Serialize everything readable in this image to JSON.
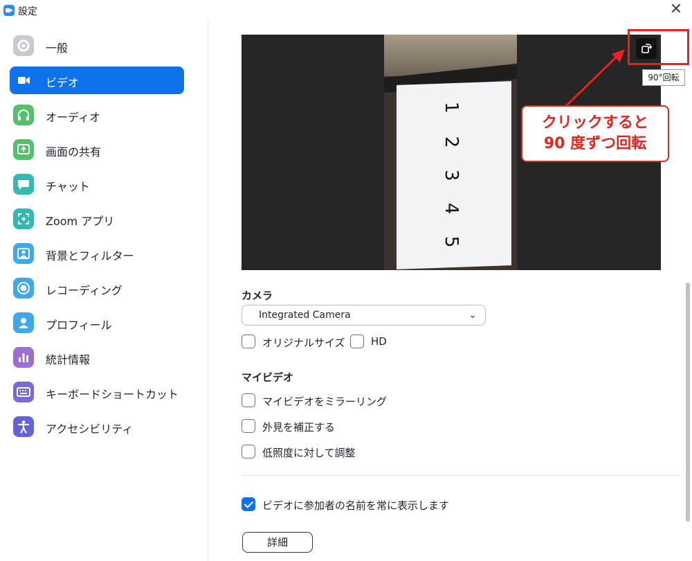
{
  "window": {
    "title": "設定",
    "close_glyph": "✕"
  },
  "sidebar": {
    "items": [
      {
        "label": "一般",
        "icon": "gear-icon",
        "color": "#c9c9cf",
        "active": false
      },
      {
        "label": "ビデオ",
        "icon": "video-camera-icon",
        "color": "#0e72ed",
        "active": true
      },
      {
        "label": "オーディオ",
        "icon": "headphones-icon",
        "color": "#54c06e",
        "active": false
      },
      {
        "label": "画面の共有",
        "icon": "screen-share-icon",
        "color": "#54c06e",
        "active": false
      },
      {
        "label": "チャット",
        "icon": "chat-bubble-icon",
        "color": "#33b8b4",
        "active": false
      },
      {
        "label": "Zoom アプリ",
        "icon": "zoom-apps-icon",
        "color": "#33b8b4",
        "active": false
      },
      {
        "label": "背景とフィルター",
        "icon": "background-filter-icon",
        "color": "#3ea8e8",
        "active": false
      },
      {
        "label": "レコーディング",
        "icon": "recording-icon",
        "color": "#3ea8e8",
        "active": false
      },
      {
        "label": "プロフィール",
        "icon": "profile-icon",
        "color": "#3ea8e8",
        "active": false
      },
      {
        "label": "統計情報",
        "icon": "statistics-icon",
        "color": "#9e6dd1",
        "active": false
      },
      {
        "label": "キーボードショートカット",
        "icon": "keyboard-icon",
        "color": "#7b68d9",
        "active": false
      },
      {
        "label": "アクセシビリティ",
        "icon": "accessibility-icon",
        "color": "#6363d9",
        "active": false
      }
    ]
  },
  "preview": {
    "paper_numbers": [
      "1",
      "2",
      "3",
      "4",
      "5"
    ],
    "rotate_tooltip": "90°回転",
    "callout_lines": [
      "クリックすると",
      "90 度ずつ回転"
    ],
    "accent_red": "#e8231e"
  },
  "camera": {
    "section_title": "カメラ",
    "selected": "Integrated Camera",
    "options": [
      {
        "label": "オリジナルサイズ",
        "checked": false
      },
      {
        "label": "HD",
        "checked": false
      }
    ]
  },
  "my_video": {
    "section_title": "マイビデオ",
    "options": [
      {
        "label": "マイビデオをミラーリング",
        "checked": false
      },
      {
        "label": "外見を補正する",
        "checked": false
      },
      {
        "label": "低照度に対して調整",
        "checked": false
      }
    ]
  },
  "always_show_names": {
    "label": "ビデオに参加者の名前を常に表示します",
    "checked": true
  },
  "detail_button": "詳細"
}
